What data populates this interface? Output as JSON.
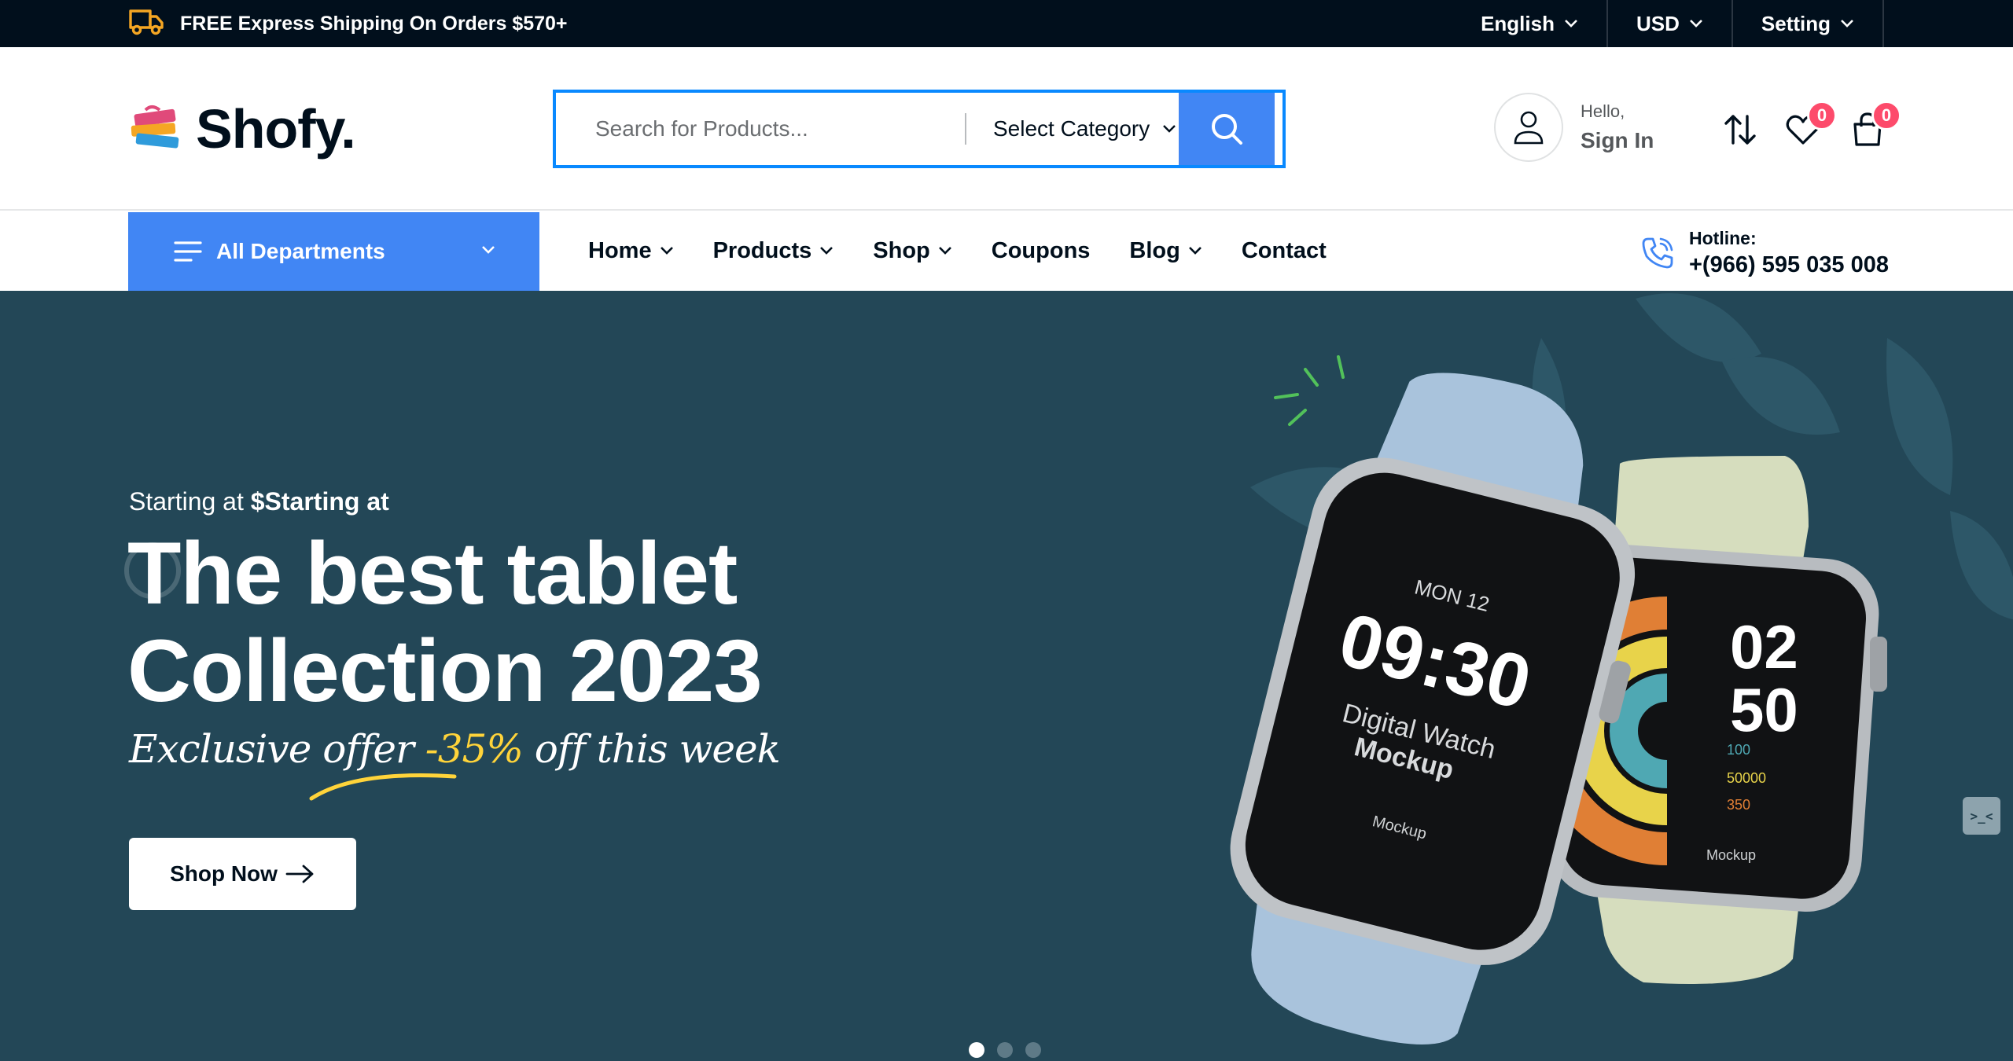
{
  "topbar": {
    "shipping_text": "FREE Express Shipping On Orders $570+",
    "language": "English",
    "currency": "USD",
    "setting": "Setting"
  },
  "header": {
    "logo": "Shofy.",
    "search": {
      "placeholder": "Search for Products...",
      "category": "Select Category"
    },
    "account": {
      "greeting": "Hello,",
      "action": "Sign In"
    },
    "wishlist_count": "0",
    "cart_count": "0"
  },
  "nav": {
    "departments": "All Departments",
    "items": [
      {
        "label": "Home",
        "dropdown": true
      },
      {
        "label": "Products",
        "dropdown": true
      },
      {
        "label": "Shop",
        "dropdown": true
      },
      {
        "label": "Coupons",
        "dropdown": false
      },
      {
        "label": "Blog",
        "dropdown": true
      },
      {
        "label": "Contact",
        "dropdown": false
      }
    ],
    "hotline_label": "Hotline:",
    "hotline_number": "+(966) 595 035 008"
  },
  "hero": {
    "starting_prefix": "Starting at",
    "starting_value": "$Starting at",
    "title_line1": "The best tablet",
    "title_line2": "Collection 2023",
    "offer_prefix": "Exclusive offer",
    "offer_percent": "-35%",
    "offer_suffix": "off this week",
    "cta": "Shop Now",
    "slides": 3,
    "active_slide": 1,
    "watch_left": {
      "day": "MON 12",
      "time": "09:30",
      "line1": "Digital Watch",
      "line2": "Mockup",
      "brand": "Mockup"
    },
    "watch_right": {
      "hours": "02",
      "minutes": "50",
      "stat1": "100",
      "stat2": "50000",
      "stat3": "350",
      "brand": "Mockup"
    }
  },
  "widget": {
    "text": ">_<"
  },
  "colors": {
    "topbar_bg": "#010f1c",
    "accent_blue": "#4186f4",
    "hero_bg": "#234757",
    "badge": "#fd4b6b",
    "offer_yellow": "#ffd43a"
  },
  "icons": [
    "truck-icon",
    "chevron-down-icon",
    "search-icon",
    "user-icon",
    "compare-icon",
    "heart-icon",
    "cart-icon",
    "menu-icon",
    "phone-icon",
    "arrow-right-icon"
  ]
}
